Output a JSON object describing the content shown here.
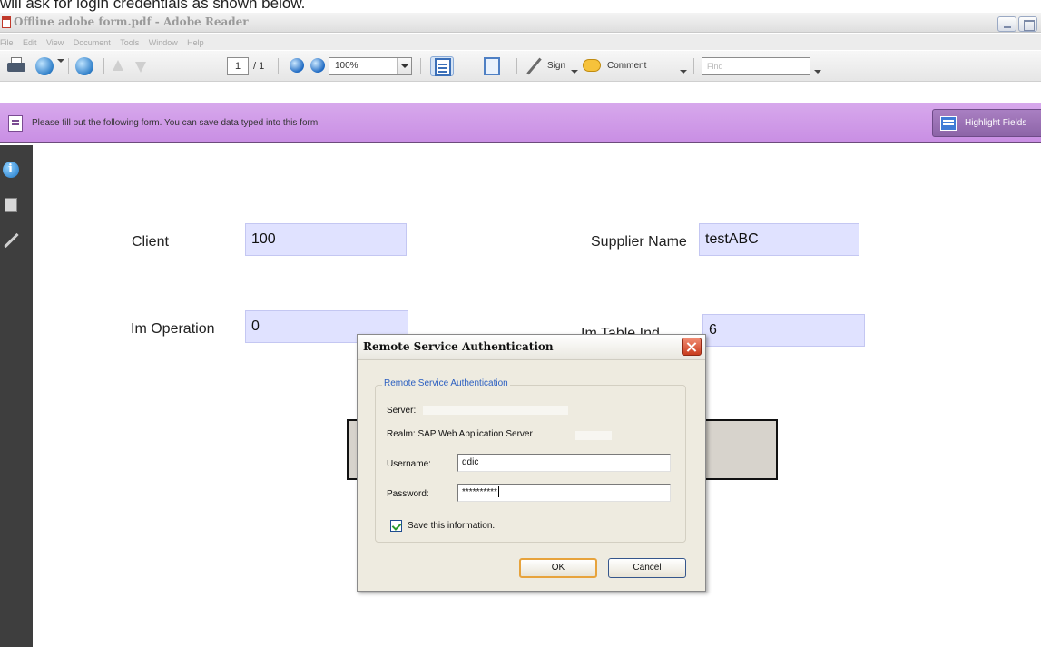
{
  "caption": "will ask for login credentials as shown below.",
  "window": {
    "title": "Offline adobe form.pdf - Adobe Reader"
  },
  "menu": [
    "File",
    "Edit",
    "View",
    "Document",
    "Tools",
    "Window",
    "Help"
  ],
  "toolbar": {
    "page_current": "1",
    "page_total": "/ 1",
    "zoom": "100%",
    "sign_label": "Sign",
    "comment_label": "Comment",
    "find_placeholder": "Find"
  },
  "message_bar": {
    "text": "Please fill out the following form. You can save data typed into this form.",
    "highlight_button": "Highlight Fields"
  },
  "form": {
    "client_label": "Client",
    "client_value": "100",
    "supplier_label": "Supplier Name",
    "supplier_value": "testABC",
    "operation_label": "Im Operation",
    "operation_value": "0",
    "table_label": "Im Table Ind",
    "table_value": "6"
  },
  "dialog": {
    "title": "Remote Service Authentication",
    "group_label": "Remote Service Authentication",
    "server_label": "Server:",
    "realm_label": "Realm: SAP Web Application Server",
    "username_label": "Username:",
    "username_value": "ddic",
    "password_label": "Password:",
    "password_value": "**********",
    "save_label": "Save this information.",
    "save_checked": true,
    "ok_label": "OK",
    "cancel_label": "Cancel"
  },
  "colors": {
    "message_bar": "#c98fe4",
    "field_fill": "#e0e2ff",
    "nav_pane": "#3e3e3e",
    "dialog_bg": "#eeebe0",
    "ok_focus": "#e7a33c"
  }
}
